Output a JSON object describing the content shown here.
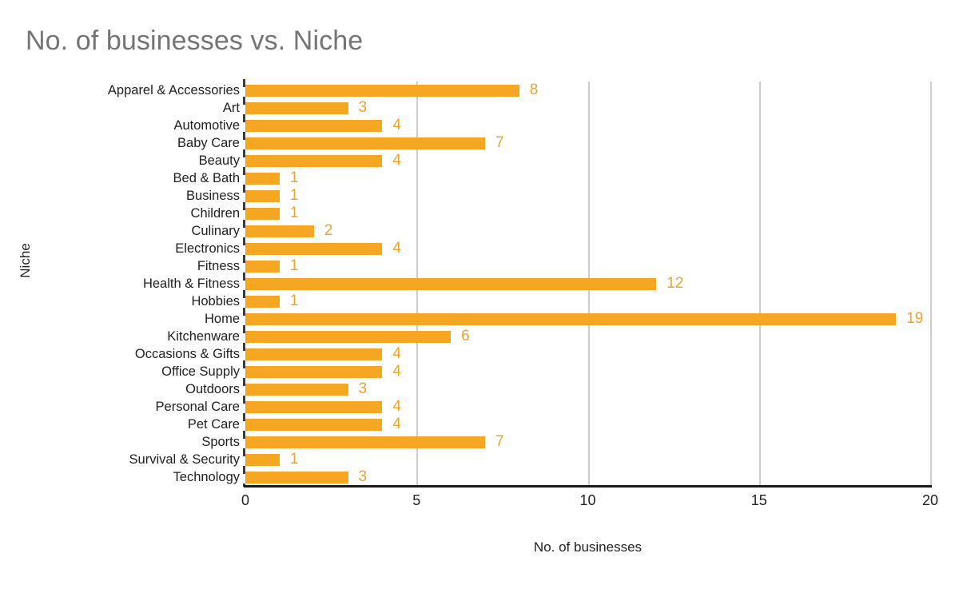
{
  "chart_data": {
    "type": "bar",
    "orientation": "horizontal",
    "title": "No. of businesses vs. Niche",
    "xlabel": "No. of businesses",
    "ylabel": "Niche",
    "xlim": [
      0,
      20
    ],
    "xticks": [
      "0",
      "5",
      "10",
      "15",
      "20"
    ],
    "grid": "vertical",
    "legend": "none",
    "show_data_labels": true,
    "bar_color": "#f5a623",
    "label_color": "#f0a12c",
    "title_color": "#757575",
    "axis_text_color": "#222222",
    "gridline_color": "#cccdcf",
    "axis_line_color": "#1a1a1a",
    "categories": [
      "Apparel & Accessories",
      "Art",
      "Automotive",
      "Baby Care",
      "Beauty",
      "Bed & Bath",
      "Business",
      "Children",
      "Culinary",
      "Electronics",
      "Fitness",
      "Health & Fitness",
      "Hobbies",
      "Home",
      "Kitchenware",
      "Occasions & Gifts",
      "Office Supply",
      "Outdoors",
      "Personal Care",
      "Pet Care",
      "Sports",
      "Survival & Security",
      "Technology"
    ],
    "values": [
      8,
      3,
      4,
      7,
      4,
      1,
      1,
      1,
      2,
      4,
      1,
      12,
      1,
      19,
      6,
      4,
      4,
      3,
      4,
      4,
      7,
      1,
      3
    ],
    "value_labels": [
      "8",
      "3",
      "4",
      "7",
      "4",
      "1",
      "1",
      "1",
      "2",
      "4",
      "1",
      "12",
      "1",
      "19",
      "6",
      "4",
      "4",
      "3",
      "4",
      "4",
      "7",
      "1",
      "3"
    ]
  }
}
